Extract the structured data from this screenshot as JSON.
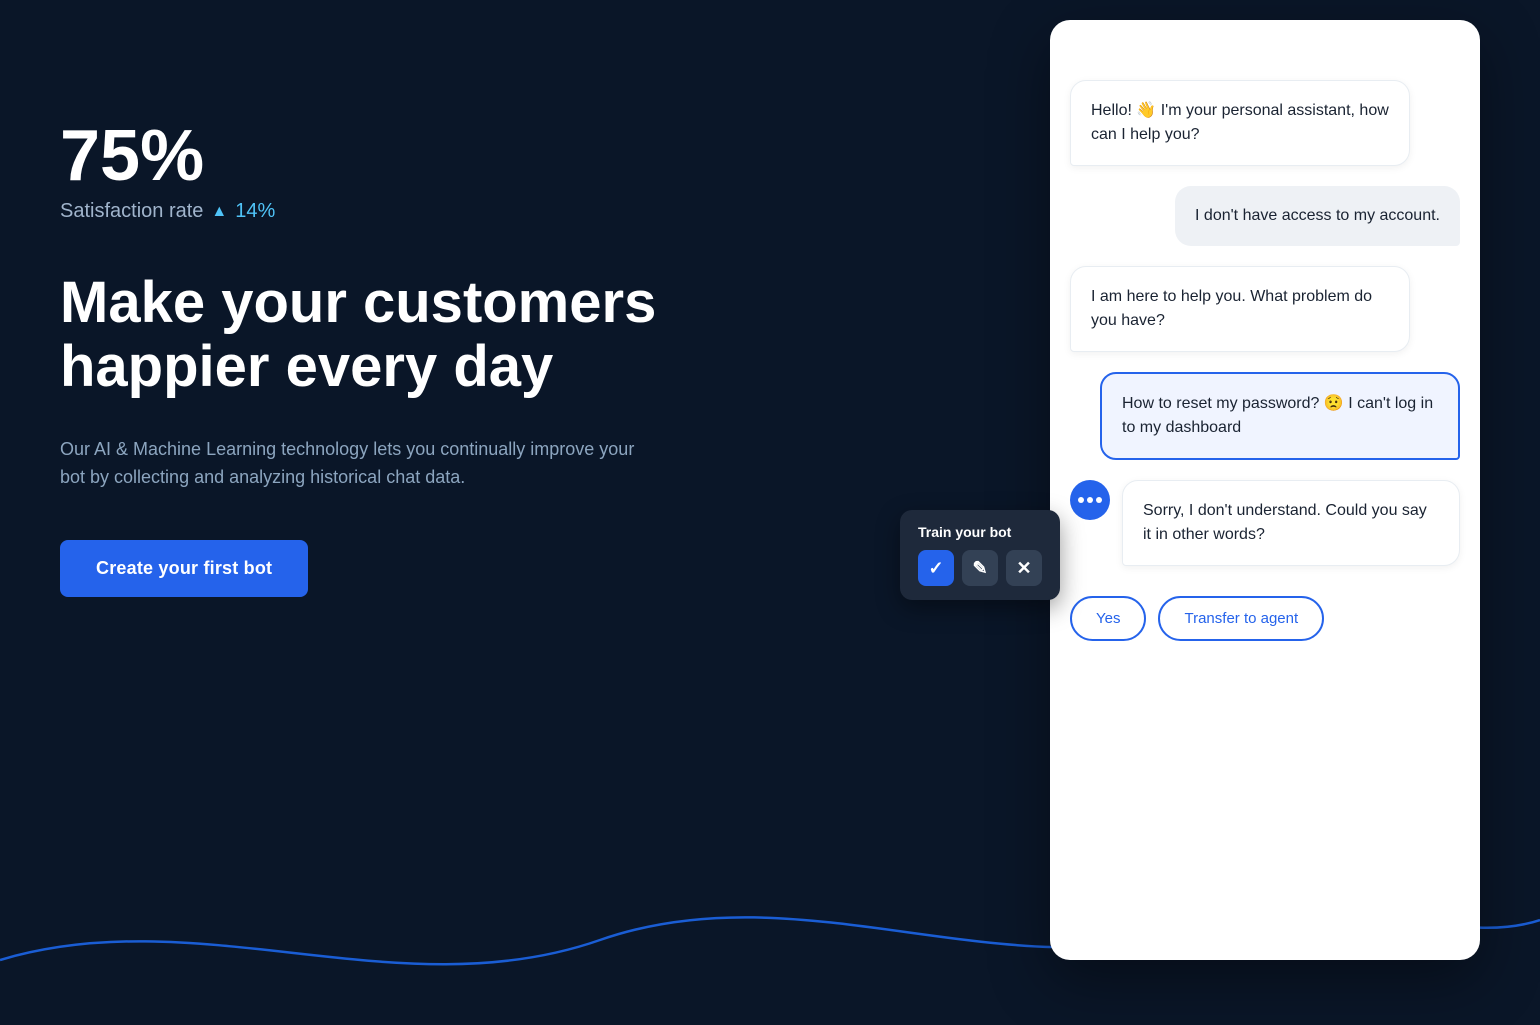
{
  "stats": {
    "percentage": "75%",
    "satisfaction_label": "Satisfaction rate",
    "trend_value": "14%"
  },
  "headline": {
    "line1": "Make your customers",
    "line2": "happier every day"
  },
  "description": "Our AI & Machine Learning technology lets you continually improve your bot by collecting and analyzing historical chat data.",
  "cta": {
    "label": "Create your first bot"
  },
  "chat": {
    "messages": [
      {
        "type": "bot",
        "text": "Hello! 👋 I'm your personal assistant, how can I help you?"
      },
      {
        "type": "user",
        "text": "I don't have access to my account."
      },
      {
        "type": "bot",
        "text": "I am here to help you. What problem do you have?"
      },
      {
        "type": "user_highlight",
        "text": "How to reset my password? 😟 I can't log in to my dashboard"
      },
      {
        "type": "bot_with_avatar",
        "text": "Sorry, I don't understand. Could you say it in other words?"
      }
    ],
    "action_buttons": [
      {
        "label": "Yes"
      },
      {
        "label": "Transfer to agent"
      }
    ]
  },
  "train_panel": {
    "title": "Train your bot",
    "buttons": [
      {
        "label": "✓",
        "type": "check"
      },
      {
        "label": "✎",
        "type": "edit"
      },
      {
        "label": "✕",
        "type": "x"
      }
    ]
  }
}
